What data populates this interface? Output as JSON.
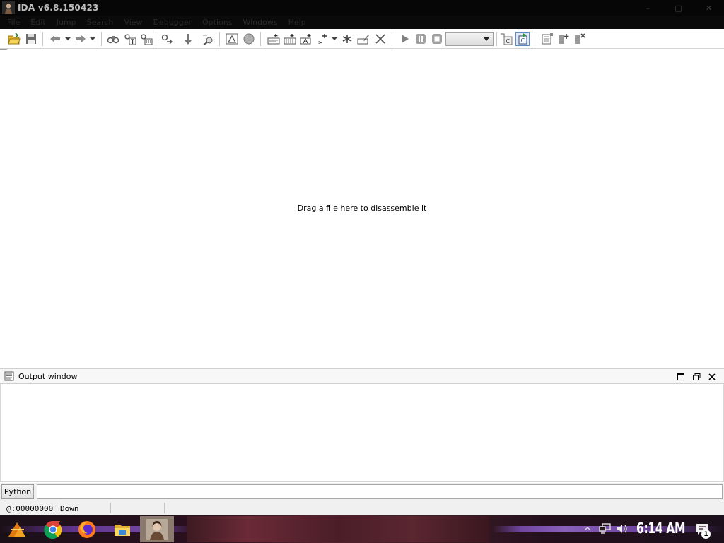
{
  "window": {
    "title": "IDA v6.8.150423",
    "controls": {
      "minimize": "–",
      "maximize": "□",
      "close": "✕"
    }
  },
  "menubar": {
    "items": [
      "File",
      "Edit",
      "Jump",
      "Search",
      "View",
      "Debugger",
      "Options",
      "Windows",
      "Help"
    ]
  },
  "toolbar": {
    "debugger_select_value": ""
  },
  "main": {
    "hint": "Drag a file here to disassemble it"
  },
  "output_window": {
    "title": "Output window",
    "content": ""
  },
  "command": {
    "language_button": "Python",
    "value": ""
  },
  "statusbar": {
    "address": "@:00000000",
    "direction": "Down",
    "extra": ""
  },
  "taskbar": {
    "clock": "6:14 AM",
    "notification_count": "1",
    "preview_label": ""
  },
  "colors": {
    "titlebar_bg": "#060606",
    "taskbar_accent": "#7d4fb8",
    "window_bg": "#ffffff"
  }
}
